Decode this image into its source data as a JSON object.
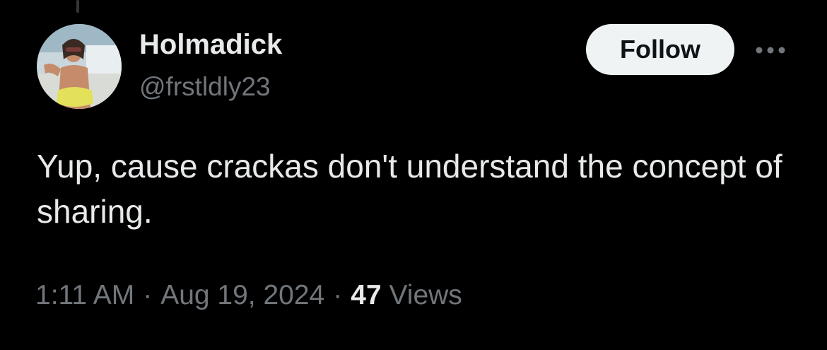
{
  "colors": {
    "background": "#000000",
    "primary_text": "#e7e9ea",
    "secondary_text": "#71767b",
    "follow_bg": "#eff3f4",
    "follow_text": "#0f1419"
  },
  "author": {
    "display_name": "Holmadick",
    "handle": "@frstldly23",
    "avatar_icon": "profile-photo"
  },
  "actions": {
    "follow_label": "Follow",
    "more_icon": "more-horizontal-icon"
  },
  "tweet": {
    "text": "Yup, cause crackas don't understand the concept of sharing."
  },
  "meta": {
    "time": "1:11 AM",
    "separator": "·",
    "date": "Aug 19, 2024",
    "views_count": "47",
    "views_label": "Views"
  }
}
